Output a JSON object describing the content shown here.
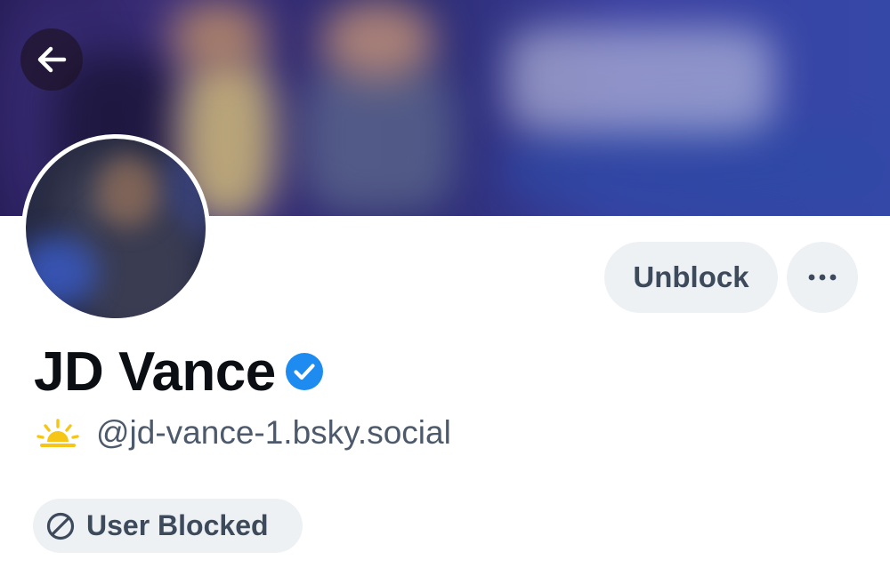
{
  "profile": {
    "display_name": "JD Vance",
    "handle": "@jd-vance-1.bsky.social",
    "verified": true
  },
  "actions": {
    "unblock_label": "Unblock",
    "more_icon": "ellipsis-icon"
  },
  "status": {
    "blocked_label": "User Blocked",
    "blocked_icon": "block-icon"
  },
  "navigation": {
    "back_icon": "arrow-left-icon"
  },
  "colors": {
    "verified_badge": "#1d8bf0",
    "sun_emoji": "#f5c518",
    "button_bg": "#eef1f4",
    "button_text": "#3c4a5c",
    "handle_text": "#4d5a6c"
  }
}
